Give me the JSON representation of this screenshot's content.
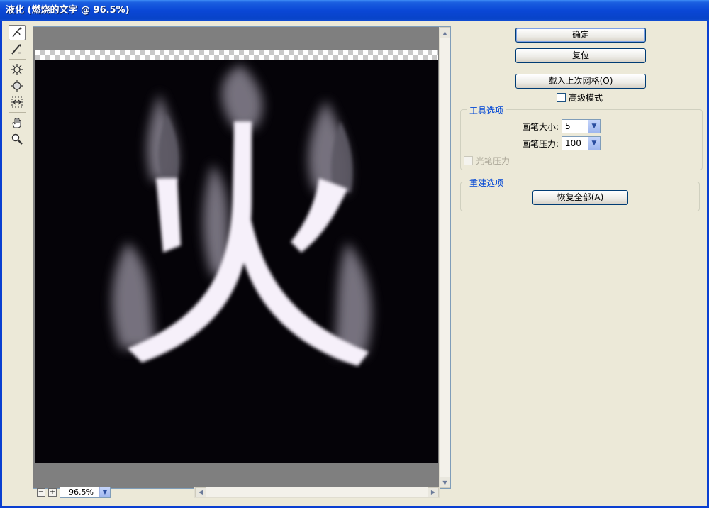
{
  "window": {
    "title": "液化 (燃烧的文字 @ 96.5%)"
  },
  "buttons": {
    "ok": "确定",
    "reset": "复位",
    "load_mesh": "载入上次网格(O)",
    "restore_all": "恢复全部(A)"
  },
  "advanced_mode": {
    "label": "高级模式",
    "checked": false
  },
  "tool_options": {
    "title": "工具选项",
    "brush_size_label": "画笔大小:",
    "brush_size_value": "5",
    "brush_pressure_label": "画笔压力:",
    "brush_pressure_value": "100",
    "stylus_pressure_label": "光笔压力"
  },
  "reconstruct": {
    "title": "重建选项"
  },
  "zoom": {
    "value": "96.5%",
    "minus": "−",
    "plus": "+"
  },
  "tools": [
    "forward-warp-icon",
    "reconstruct-icon",
    "pucker-icon",
    "bloat-icon",
    "push-left-icon",
    "hand-icon",
    "zoom-icon"
  ],
  "canvas_glyph": "火"
}
